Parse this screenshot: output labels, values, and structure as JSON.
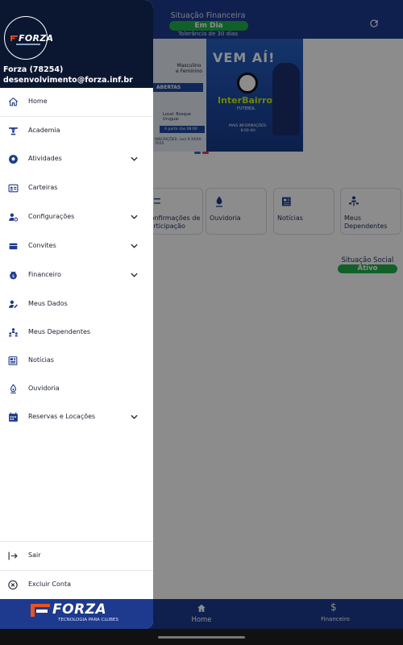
{
  "background": {
    "financial": {
      "title": "Situação Financeira",
      "status": "Em Dia",
      "tolerance": "Tolerância de 30 dias"
    },
    "banner": {
      "left_masc": "Masculino\ne Feminino",
      "left_abertas": "ABERTAS",
      "left_local": "Local: Bosque Uruguai",
      "left_horario": "A partir das 08:00",
      "left_inscricoes": "INSCRIÇÕES: (xx) 9 XXXX-7015",
      "right_headline": "VEM AÍ!",
      "right_title": "InterBairros",
      "right_sub": "FUTEBOL",
      "right_info": "MAIS INFORMAÇÕES:\n8:00-4H"
    },
    "tiles": [
      {
        "label": "Confirmações de\nParticipação",
        "icon": "check-list-icon"
      },
      {
        "label": "Ouvidoria",
        "icon": "ouvidoria-icon"
      },
      {
        "label": "Notícias",
        "icon": "news-icon"
      },
      {
        "label": "Meus\nDependentes",
        "icon": "dependents-icon"
      }
    ],
    "social": {
      "title": "Situação Social",
      "status": "Ativo"
    },
    "bottom_nav": {
      "home": "Home",
      "financeiro": "Financeiro"
    }
  },
  "drawer": {
    "logo_text": "FORZA",
    "user_name": "Forza (78254)",
    "user_email": "desenvolvimento@forza.inf.br",
    "menu": [
      {
        "label": "Home",
        "icon": "home-icon",
        "chevron": false
      },
      {
        "label": "Academia",
        "icon": "gym-icon",
        "chevron": false
      },
      {
        "label": "Atividades",
        "icon": "soccer-ball-icon",
        "chevron": true
      },
      {
        "label": "Carteiras",
        "icon": "id-card-icon",
        "chevron": false
      },
      {
        "label": "Configurações",
        "icon": "user-settings-icon",
        "chevron": true
      },
      {
        "label": "Convites",
        "icon": "invitation-icon",
        "chevron": true
      },
      {
        "label": "Financeiro",
        "icon": "money-icon",
        "chevron": true
      },
      {
        "label": "Meus Dados",
        "icon": "user-edit-icon",
        "chevron": false
      },
      {
        "label": "Meus Dependentes",
        "icon": "dependents-icon",
        "chevron": false
      },
      {
        "label": "Notícias",
        "icon": "news-icon",
        "chevron": false
      },
      {
        "label": "Ouvidoria",
        "icon": "ouvidoria-icon",
        "chevron": false
      },
      {
        "label": "Reservas e Locações",
        "icon": "calendar-icon",
        "chevron": true
      }
    ],
    "footer_menu": [
      {
        "label": "Sair",
        "icon": "logout-icon"
      },
      {
        "label": "Excluir Conta",
        "icon": "delete-circle-icon"
      }
    ],
    "brand": {
      "name": "FORZA",
      "tagline": "TECNOLOGIA PARA CLUBES"
    }
  },
  "colors": {
    "primary": "#1d3a8f",
    "dark": "#0b1730",
    "success": "#22b04b"
  }
}
